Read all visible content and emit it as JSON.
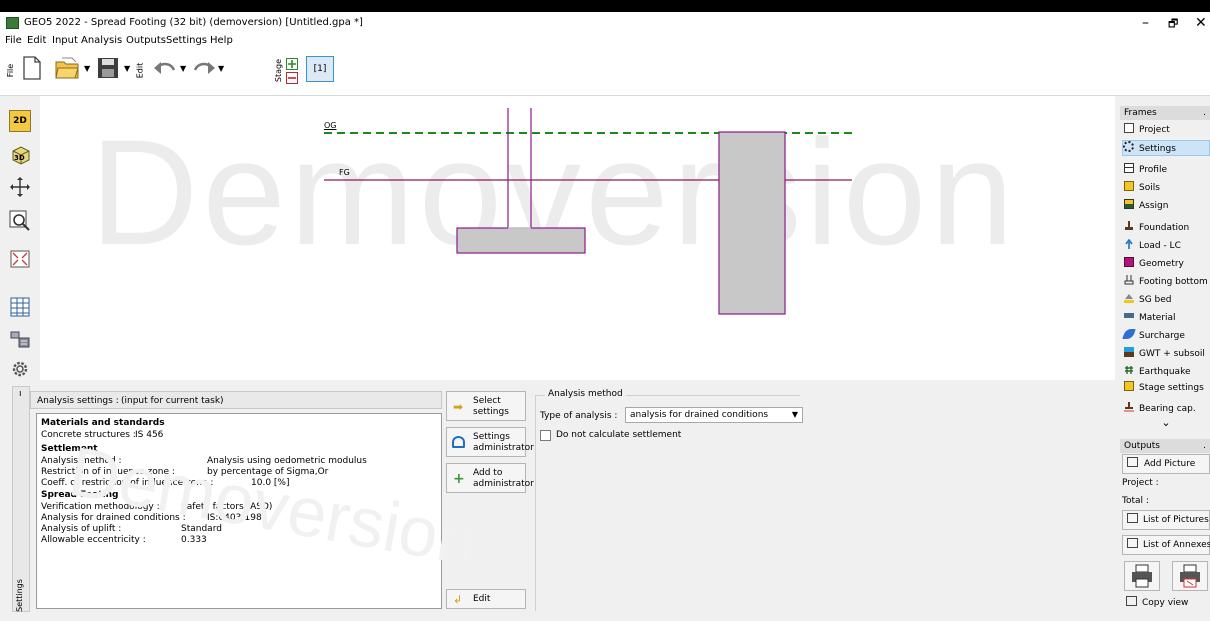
{
  "window": {
    "title": "GEO5 2022 - Spread Footing (32 bit) (demoversion) [Untitled.gpa *]",
    "minimize": "–",
    "maximize": "🗗",
    "close": "✕"
  },
  "menu": [
    "File",
    "Edit",
    "Input",
    "Analysis",
    "Outputs",
    "Settings",
    "Help"
  ],
  "toolbar": {
    "file_label": "File",
    "edit_label": "Edit",
    "stage_label": "Stage",
    "stage_number": "[1]"
  },
  "left_tools": [
    "2d-view",
    "3d-view",
    "move",
    "zoom",
    "fit-view",
    "table-view",
    "layer-view",
    "gear"
  ],
  "left_tools_2d_label": "2D",
  "left_tools_3d_label": "3D",
  "canvas": {
    "watermark": "Demoversion",
    "og_label": "OG",
    "fg_label": "FG"
  },
  "frames": {
    "header": "Frames",
    "items": [
      {
        "label": "Project",
        "icon": "document-icon"
      },
      {
        "label": "Settings",
        "icon": "gear-icon",
        "selected": true
      },
      {
        "label": "Profile",
        "icon": "profile-icon"
      },
      {
        "label": "Soils",
        "icon": "soils-icon"
      },
      {
        "label": "Assign",
        "icon": "assign-icon"
      },
      {
        "label": "Foundation",
        "icon": "foundation-icon"
      },
      {
        "label": "Load - LC",
        "icon": "load-icon"
      },
      {
        "label": "Geometry",
        "icon": "geometry-icon"
      },
      {
        "label": "Footing bottom",
        "icon": "footing-bottom-icon"
      },
      {
        "label": "SG bed",
        "icon": "sg-bed-icon"
      },
      {
        "label": "Material",
        "icon": "material-icon"
      },
      {
        "label": "Surcharge",
        "icon": "surcharge-icon"
      },
      {
        "label": "GWT + subsoil",
        "icon": "gwt-icon"
      },
      {
        "label": "Earthquake",
        "icon": "earthquake-icon"
      },
      {
        "label": "Stage settings",
        "icon": "stage-settings-icon"
      },
      {
        "label": "Bearing cap.",
        "icon": "bearing-icon"
      }
    ],
    "scroll": "⌄"
  },
  "outputs": {
    "header": "Outputs",
    "add_picture": "Add Picture",
    "project_label": "Project :",
    "total_label": "Total :",
    "list_pictures": "List of Pictures",
    "list_annexes": "List of Annexes",
    "copy_view": "Copy view"
  },
  "settings_panel": {
    "strip_label": "Settings",
    "analysis_settings_label": "Analysis settings :",
    "analysis_settings_value": "(input for current task)",
    "sections": [
      {
        "title": "Materials and standards",
        "rows": [
          {
            "label": "Concrete structures :",
            "value": "IS 456"
          }
        ]
      },
      {
        "title": "Settlement",
        "rows": [
          {
            "label": "Analysis method :",
            "value": "Analysis using oedometric modulus"
          },
          {
            "label": "Restriction of influence zone :",
            "value": "by percentage of Sigma,Or"
          },
          {
            "label": "Coeff. of restriction of influence zone :",
            "value": "10.0 [%]"
          }
        ]
      },
      {
        "title": "Spread Footing",
        "rows": [
          {
            "label": "Verification methodology :",
            "value": "Safety factors (ASD)"
          },
          {
            "label": "Analysis for drained conditions :",
            "value": "IS:6403-1981"
          },
          {
            "label": "Analysis of uplift :",
            "value": "Standard"
          },
          {
            "label": "Allowable eccentricity :",
            "value": "0.333"
          }
        ]
      }
    ],
    "buttons": {
      "select_settings": [
        "Select",
        "settings"
      ],
      "settings_admin": [
        "Settings",
        "administrator"
      ],
      "add_admin": [
        "Add to",
        "administrator"
      ],
      "edit": "Edit"
    }
  },
  "analysis_method": {
    "group_title": "Analysis method",
    "type_label": "Type of analysis :",
    "type_value": "analysis for drained conditions",
    "no_settlement_label": "Do not calculate settlement",
    "no_settlement_checked": false
  }
}
